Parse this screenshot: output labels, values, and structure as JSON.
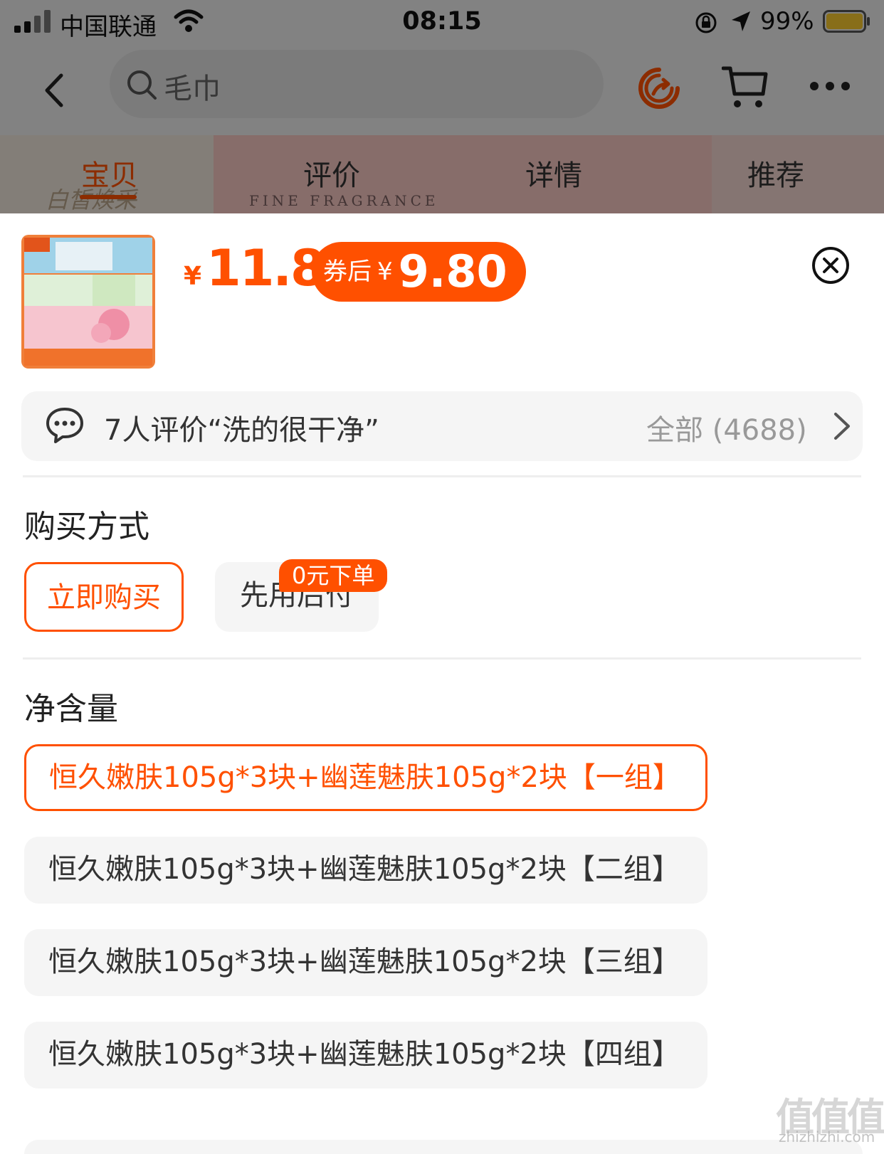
{
  "status_bar": {
    "carrier": "中国联通",
    "time": "08:15",
    "battery": "99%"
  },
  "nav": {
    "search_placeholder": "毛巾",
    "icons": [
      "back-icon",
      "search-icon",
      "share-icon",
      "cart-icon",
      "more-icon"
    ]
  },
  "tabs": [
    {
      "label": "宝贝",
      "active": true
    },
    {
      "label": "评价",
      "active": false
    },
    {
      "label": "详情",
      "active": false
    },
    {
      "label": "推荐",
      "active": false
    }
  ],
  "background_image_text": {
    "fine_fragrance": "FINE FRAGRANCE",
    "script": "白皙焕采"
  },
  "sku": {
    "price_symbol": "¥",
    "price": "11.8",
    "coupon_label": "券后",
    "coupon_symbol": "¥",
    "coupon_price": "9.80"
  },
  "review": {
    "summary": "7人评价“洗的很干净”",
    "all_label": "全部 (4688)"
  },
  "purchase": {
    "title": "购买方式",
    "options": [
      {
        "label": "立即购买",
        "selected": true
      },
      {
        "label": "先用后付",
        "selected": false,
        "badge": "0元下单"
      }
    ]
  },
  "net_content": {
    "title": "净含量",
    "options": [
      {
        "label": "恒久嫩肤105g*3块+幽莲魅肤105g*2块【一组】",
        "selected": true
      },
      {
        "label": "恒久嫩肤105g*3块+幽莲魅肤105g*2块【二组】",
        "selected": false
      },
      {
        "label": "恒久嫩肤105g*3块+幽莲魅肤105g*2块【三组】",
        "selected": false
      },
      {
        "label": "恒久嫩肤105g*3块+幽莲魅肤105g*2块【四组】",
        "selected": false
      }
    ]
  },
  "watermark": {
    "logo": "值值值",
    "url": "zhizhizhi.com"
  },
  "colors": {
    "accent": "#ff5000",
    "chip_bg": "#f5f5f5"
  }
}
